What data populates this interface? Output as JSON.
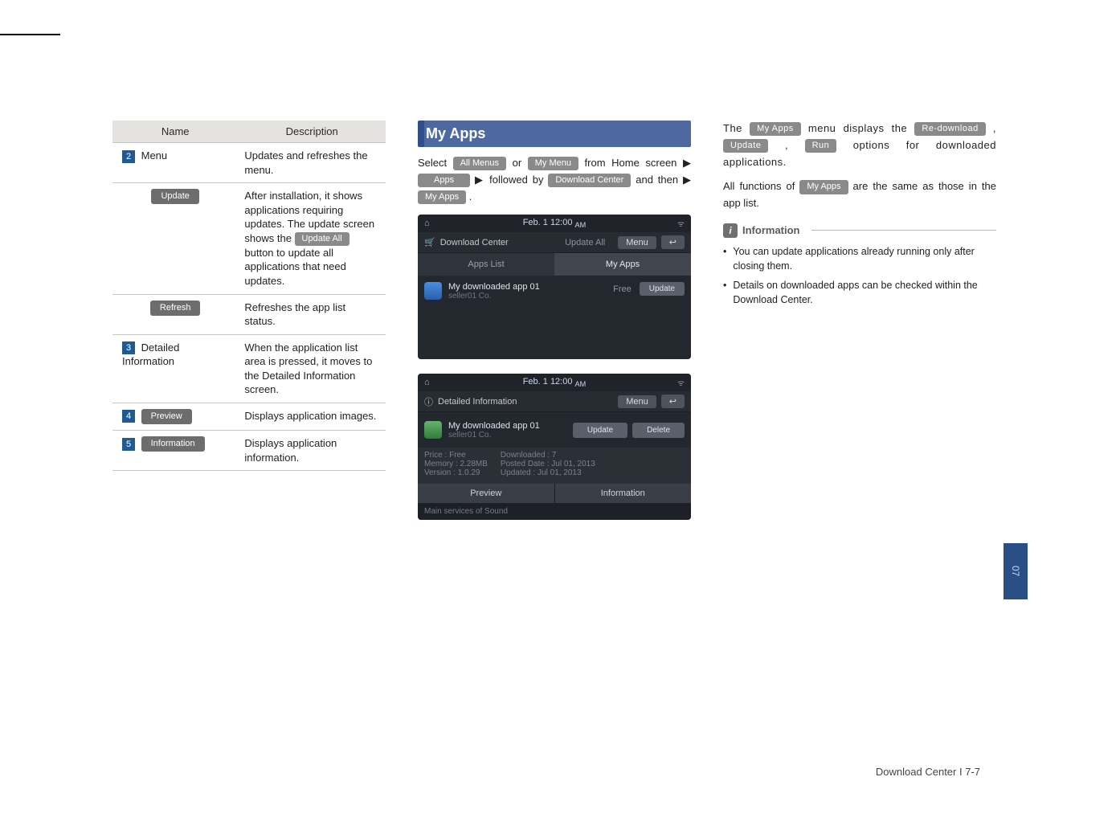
{
  "table": {
    "headers": [
      "Name",
      "Description"
    ],
    "rows": [
      {
        "num": "2",
        "name": "Menu",
        "desc": "Updates and refreshes the menu."
      },
      {
        "num": "",
        "name_btn": "Update",
        "desc_pre": "After installation, it shows applications requiring updates. The update screen shows the ",
        "inline_btn": "Update All",
        "desc_post": " button to update all applications that need updates."
      },
      {
        "num": "",
        "name_btn": "Refresh",
        "desc": "Refreshes the app list status."
      },
      {
        "num": "3",
        "name": "Detailed Information",
        "desc": "When the application list area is pressed, it moves to the Detailed Information screen."
      },
      {
        "num": "4",
        "name_btn": "Preview",
        "desc": "Displays application images."
      },
      {
        "num": "5",
        "name_btn": "Information",
        "desc": "Displays application information."
      }
    ]
  },
  "col2": {
    "title": "My Apps",
    "p1_pre": "Select ",
    "btn_allmenus": "All Menus",
    "p1_or": " or ",
    "btn_mymenu": "My Menu",
    "p1_post": " from Home screen ▶ ",
    "btn_apps": "Apps",
    "p1_fol": "  ▶  followed  by ",
    "btn_dlcenter": "Download Center",
    "p1_then": " and then ▶ ",
    "btn_myapps": "My Apps",
    "p1_end": " ."
  },
  "shot1": {
    "time": "Feb.  1   12:00",
    "ampm": "AM",
    "crumb": "Download Center",
    "updateall": "Update All",
    "menu": "Menu",
    "tab_left": "Apps List",
    "tab_right": "My Apps",
    "app_name": "My downloaded app 01",
    "app_sub": "seller01 Co.",
    "price": "Free",
    "updatebtn": "Update"
  },
  "shot2": {
    "time": "Feb.  1   12:00",
    "ampm": "AM",
    "crumb": "Detailed Information",
    "menu": "Menu",
    "app_name": "My downloaded app 01",
    "app_sub": "seller01 Co.",
    "btn_update": "Update",
    "btn_delete": "Delete",
    "l1": "Price : Free",
    "l2": "Memory : 2.28MB",
    "l3": "Version : 1.0.29",
    "r1": "Downloaded : 7",
    "r2": "Posted Date : Jul 01, 2013",
    "r3": "Updated : Jul 01, 2013",
    "t_preview": "Preview",
    "t_info": "Information",
    "footer": "Main services of Sound"
  },
  "col3": {
    "p1_pre": "The ",
    "btn_myapps": "My Apps",
    "p1_mid": " menu displays the ",
    "btn_redl": "Re-download",
    "sep1": " , ",
    "btn_update": "Update",
    "sep2": " , ",
    "btn_run": "Run",
    "p1_post": " options for downloaded applications.",
    "p2_pre": "All functions of ",
    "p2_btn": "My Apps",
    "p2_post": " are the same as those in the app list.",
    "info_label": "Information",
    "bul1": "You can update applications already running only after closing them.",
    "bul2": "Details on downloaded apps can be checked within the Download Center."
  },
  "side_tab": "07",
  "footer": "Download Center I 7-7"
}
